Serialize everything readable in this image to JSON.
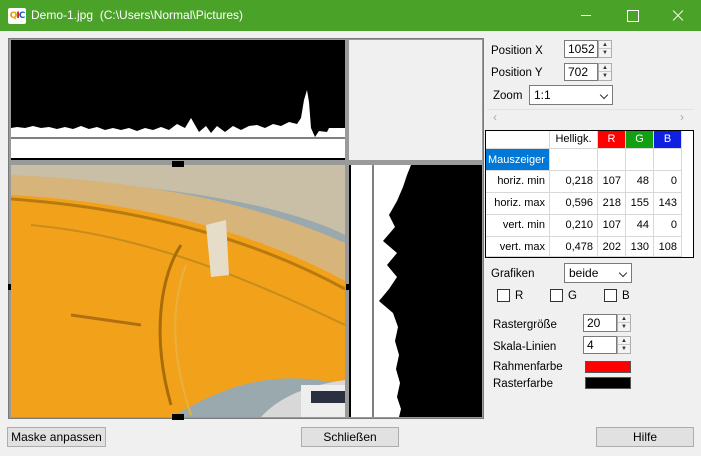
{
  "window": {
    "title": "Demo-1.jpg  (C:\\Users\\Normal\\Pictures)",
    "icon": "app-icon",
    "icon_text": [
      "Q",
      "I",
      "C"
    ]
  },
  "position": {
    "x_label": "Position X",
    "x_value": "1052",
    "y_label": "Position Y",
    "y_value": "702"
  },
  "zoom": {
    "label": "Zoom",
    "value": "1:1"
  },
  "scrollbar": {
    "left_arrow": "‹",
    "right_arrow": "›"
  },
  "stats": {
    "columns": [
      "Helligk.",
      "R",
      "G",
      "B"
    ],
    "header_colors": {
      "R": "#ff0000",
      "G": "#10a010",
      "B": "#1020e0"
    },
    "selected_row_label": "Mauszeiger",
    "rows": [
      {
        "label": "horiz. min",
        "values": [
          "0,218",
          "107",
          "48",
          "0"
        ]
      },
      {
        "label": "horiz. max",
        "values": [
          "0,596",
          "218",
          "155",
          "143"
        ]
      },
      {
        "label": "vert. min",
        "values": [
          "0,210",
          "107",
          "44",
          "0"
        ]
      },
      {
        "label": "vert. max",
        "values": [
          "0,478",
          "202",
          "130",
          "108"
        ]
      }
    ]
  },
  "grafiken": {
    "label": "Grafiken",
    "value": "beide",
    "checkboxes": [
      {
        "label": "R",
        "checked": false
      },
      {
        "label": "G",
        "checked": false
      },
      {
        "label": "B",
        "checked": false
      }
    ]
  },
  "raster": {
    "size_label": "Rastergröße",
    "size_value": "20",
    "lines_label": "Skala-Linien",
    "lines_value": "4",
    "frame_color_label": "Rahmenfarbe",
    "frame_color": "#ff0000",
    "raster_color_label": "Rasterfarbe",
    "raster_color": "#000000"
  },
  "buttons": {
    "mask": "Maske anpassen",
    "close": "Schließen",
    "help": "Hilfe"
  },
  "colors": {
    "titlebar": "#4aa328",
    "selection": "#0078d7",
    "photo_yellow": "#f2a21a"
  }
}
